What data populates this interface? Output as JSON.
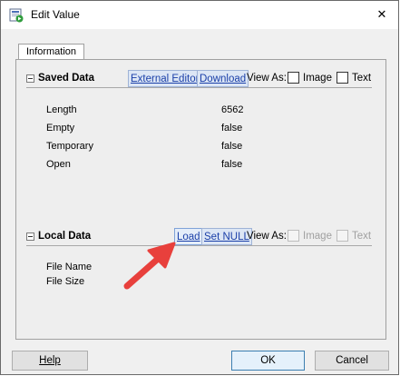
{
  "window": {
    "title": "Edit Value",
    "close_symbol": "✕"
  },
  "tabs": [
    {
      "label": "Information",
      "active": true
    }
  ],
  "saved_data": {
    "title": "Saved Data",
    "external_editor_label": "External Editor",
    "download_label": "Download",
    "view_as_label": "View As:",
    "image_label": "Image",
    "text_label": "Text",
    "image_checked": false,
    "text_checked": false,
    "properties": [
      {
        "label": "Length",
        "value": "6562"
      },
      {
        "label": "Empty",
        "value": "false"
      },
      {
        "label": "Temporary",
        "value": "false"
      },
      {
        "label": "Open",
        "value": "false"
      }
    ]
  },
  "local_data": {
    "title": "Local Data",
    "load_label": "Load",
    "set_null_label": "Set NULL",
    "view_as_label": "View As:",
    "image_label": "Image",
    "text_label": "Text",
    "image_enabled": false,
    "text_enabled": false,
    "properties": [
      {
        "label": "File Name",
        "value": ""
      },
      {
        "label": "File Size",
        "value": ""
      }
    ]
  },
  "footer": {
    "help_label": "Help",
    "ok_label": "OK",
    "cancel_label": "Cancel"
  },
  "colors": {
    "link": "#1a3fa8",
    "arrow": "#e8403c",
    "default_button_border": "#3c7fb1"
  },
  "icons": {
    "app": "edit-value-app-icon",
    "close": "close-icon",
    "annotation": "red-arrow-annotation"
  }
}
